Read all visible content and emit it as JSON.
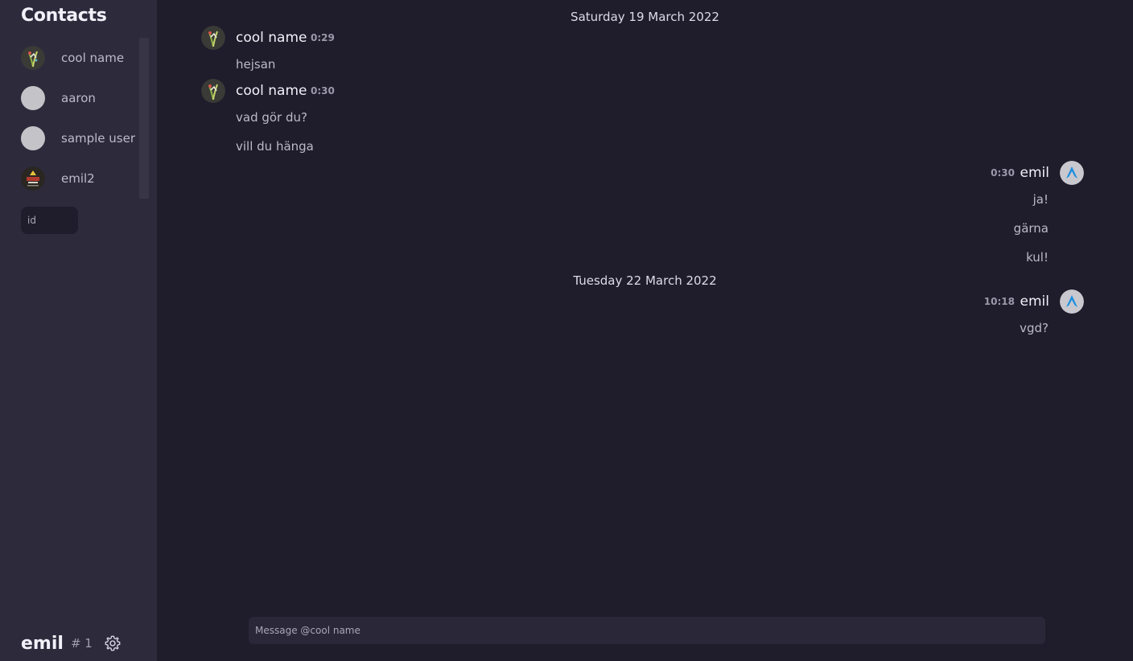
{
  "sidebar": {
    "title": "Contacts",
    "contacts": [
      {
        "name": "cool name",
        "avatar": "plant-art-avatar"
      },
      {
        "name": "aaron",
        "avatar": "default-gray-avatar"
      },
      {
        "name": "sample user",
        "avatar": "default-gray-avatar"
      },
      {
        "name": "emil2",
        "avatar": "dark-poster-avatar"
      }
    ],
    "id_input": {
      "placeholder": "id",
      "value": ""
    }
  },
  "user_bar": {
    "name": "emil",
    "tag": "# 1",
    "settings_icon": "gear-icon"
  },
  "chat": {
    "groups": [
      {
        "type": "date",
        "label": "Saturday 19 March 2022"
      },
      {
        "type": "message",
        "author": "cool name",
        "time": "0:29",
        "side": "left",
        "lines": [
          "hejsan"
        ]
      },
      {
        "type": "message",
        "author": "cool name",
        "time": "0:30",
        "side": "left",
        "lines": [
          "vad gör du?",
          "vill du hänga"
        ]
      },
      {
        "type": "message",
        "author": "emil",
        "time": "0:30",
        "side": "right",
        "lines": [
          "ja!",
          "gärna",
          "kul!"
        ]
      },
      {
        "type": "date",
        "label": "Tuesday 22 March 2022"
      },
      {
        "type": "message",
        "author": "emil",
        "time": "10:18",
        "side": "right",
        "lines": [
          "vgd?"
        ]
      }
    ],
    "composer": {
      "placeholder": "Message @cool name",
      "value": ""
    }
  },
  "colors": {
    "sidebar_bg": "#2d2a3c",
    "main_bg": "#1f1c2b",
    "composer_bg": "#2a2739",
    "accent_blue": "#1f8fe0"
  }
}
